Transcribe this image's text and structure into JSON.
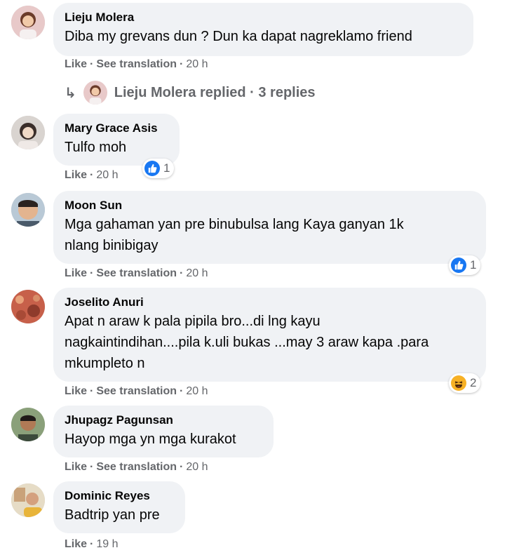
{
  "comments": [
    {
      "author": "Lieju Molera",
      "text": "Diba my grevans dun ? Dun ka dapat nagreklamo friend",
      "like": "Like",
      "translate": "See translation",
      "time": "20 h",
      "replies_label": "Lieju Molera replied · 3 replies"
    },
    {
      "author": "Mary Grace Asis",
      "text": "Tulfo moh",
      "like": "Like",
      "time": "20 h",
      "reaction_icon": "like-icon",
      "reaction_count": "1"
    },
    {
      "author": "Moon Sun",
      "text": "Mga gahaman yan pre binubulsa lang Kaya ganyan 1k\nnlang binibigay",
      "like": "Like",
      "translate": "See translation",
      "time": "20 h",
      "reaction_icon": "like-icon",
      "reaction_count": "1"
    },
    {
      "author": "Joselito Anuri",
      "text": "Apat n araw k pala pipila bro...di lng kayu\nnagkaintindihan....pila k.uli bukas ...may 3 araw kapa .para\nmkumpleto n",
      "like": "Like",
      "translate": "See translation",
      "time": "20 h",
      "reaction_icon": "haha-icon",
      "reaction_count": "2"
    },
    {
      "author": "Jhupagz Pagunsan",
      "text": "Hayop mga yn mga kurakot",
      "like": "Like",
      "translate": "See translation",
      "time": "20 h"
    },
    {
      "author": "Dominic Reyes",
      "text": "Badtrip yan pre",
      "like": "Like",
      "time": "19 h"
    }
  ],
  "colors": {
    "bubble": "#f0f2f5",
    "meta": "#65676b",
    "like_blue": "#1877f2",
    "haha_yellow": "#f7b125"
  }
}
